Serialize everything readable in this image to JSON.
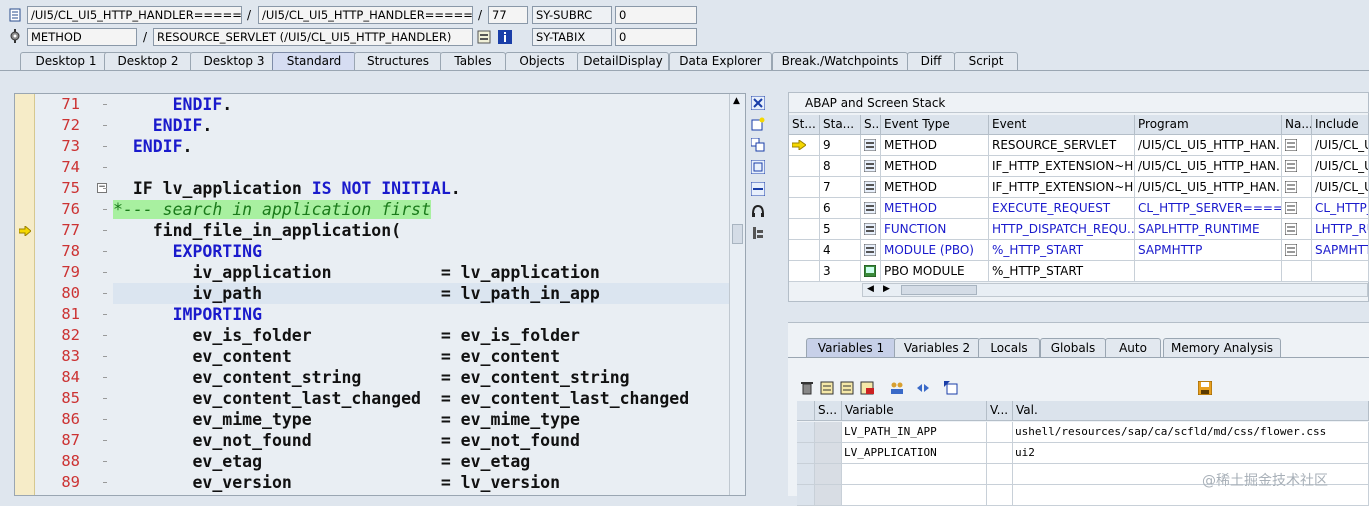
{
  "top_fields": {
    "row1": {
      "class1": "/UI5/CL_UI5_HTTP_HANDLER=====",
      "sep1": "/",
      "class2": "/UI5/CL_UI5_HTTP_HANDLER=====",
      "sep2": "/",
      "line": "77",
      "sys_label": "SY-SUBRC",
      "sys_value": "0"
    },
    "row2": {
      "type": "METHOD",
      "sep1": "/",
      "method": "RESOURCE_SERVLET (/UI5/CL_UI5_HTTP_HANDLER)",
      "sys_label": "SY-TABIX",
      "sys_value": "0"
    }
  },
  "tabs": [
    "Desktop 1",
    "Desktop 2",
    "Desktop 3",
    "Standard",
    "Structures",
    "Tables",
    "Objects",
    "DetailDisplay",
    "Data Explorer",
    "Break./Watchpoints",
    "Diff",
    "Script"
  ],
  "code_lines": [
    {
      "num": "71",
      "parts": [
        {
          "t": "      ",
          "c": ""
        },
        {
          "t": "ENDIF",
          "c": "kw"
        },
        {
          "t": ".",
          "c": ""
        }
      ]
    },
    {
      "num": "72",
      "parts": [
        {
          "t": "    ",
          "c": ""
        },
        {
          "t": "ENDIF",
          "c": "kw"
        },
        {
          "t": ".",
          "c": ""
        }
      ]
    },
    {
      "num": "73",
      "parts": [
        {
          "t": "  ",
          "c": ""
        },
        {
          "t": "ENDIF",
          "c": "kw"
        },
        {
          "t": ".",
          "c": ""
        }
      ]
    },
    {
      "num": "74",
      "parts": []
    },
    {
      "num": "75",
      "parts": [
        {
          "t": "  ",
          "c": ""
        },
        {
          "t": "IF",
          "c": ""
        },
        {
          "t": " lv_application ",
          "c": ""
        },
        {
          "t": "IS NOT INITIAL",
          "c": "kw"
        },
        {
          "t": ".",
          "c": ""
        }
      ]
    },
    {
      "num": "76",
      "parts": [
        {
          "t": "*--- search in application first",
          "c": "cm"
        }
      ]
    },
    {
      "num": "77",
      "parts": [
        {
          "t": "    find_file_in_application(",
          "c": ""
        }
      ]
    },
    {
      "num": "78",
      "parts": [
        {
          "t": "      ",
          "c": ""
        },
        {
          "t": "EXPORTING",
          "c": "kw"
        }
      ]
    },
    {
      "num": "79",
      "parts": [
        {
          "t": "        iv_application           = lv_application",
          "c": ""
        }
      ]
    },
    {
      "num": "80",
      "parts": [
        {
          "t": "        iv_path                  = lv_path_in_app",
          "c": ""
        }
      ]
    },
    {
      "num": "81",
      "parts": [
        {
          "t": "      ",
          "c": ""
        },
        {
          "t": "IMPORTING",
          "c": "kw"
        }
      ]
    },
    {
      "num": "82",
      "parts": [
        {
          "t": "        ev_is_folder             = ev_is_folder",
          "c": ""
        }
      ]
    },
    {
      "num": "83",
      "parts": [
        {
          "t": "        ev_content               = ev_content",
          "c": ""
        }
      ]
    },
    {
      "num": "84",
      "parts": [
        {
          "t": "        ev_content_string        = ev_content_string",
          "c": ""
        }
      ]
    },
    {
      "num": "85",
      "parts": [
        {
          "t": "        ev_content_last_changed  = ev_content_last_changed",
          "c": ""
        }
      ]
    },
    {
      "num": "86",
      "parts": [
        {
          "t": "        ev_mime_type             = ev_mime_type",
          "c": ""
        }
      ]
    },
    {
      "num": "87",
      "parts": [
        {
          "t": "        ev_not_found             = ev_not_found",
          "c": ""
        }
      ]
    },
    {
      "num": "88",
      "parts": [
        {
          "t": "        ev_etag                  = ev_etag",
          "c": ""
        }
      ]
    },
    {
      "num": "89",
      "parts": [
        {
          "t": "        ev_version               = lv_version",
          "c": ""
        }
      ]
    }
  ],
  "stack": {
    "title": "ABAP and Screen Stack",
    "headers": [
      "St...",
      "Sta...",
      "S...",
      "Event Type",
      "Event",
      "Program",
      "Na...",
      "Include"
    ],
    "rows": [
      {
        "level": "9",
        "type": "METHOD",
        "event": "RESOURCE_SERVLET",
        "program": "/UI5/CL_UI5_HTTP_HAN...",
        "include": "/UI5/CL_U",
        "current": true,
        "link": false
      },
      {
        "level": "8",
        "type": "METHOD",
        "event": "IF_HTTP_EXTENSION~H...",
        "program": "/UI5/CL_UI5_HTTP_HAN...",
        "include": "/UI5/CL_U",
        "current": false,
        "link": false
      },
      {
        "level": "7",
        "type": "METHOD",
        "event": "IF_HTTP_EXTENSION~H...",
        "program": "/UI5/CL_UI5_HTTP_HAN...",
        "include": "/UI5/CL_U",
        "current": false,
        "link": false
      },
      {
        "level": "6",
        "type": "METHOD",
        "event": "EXECUTE_REQUEST",
        "program": "CL_HTTP_SERVER====...",
        "include": "CL_HTTP_S",
        "current": false,
        "link": true
      },
      {
        "level": "5",
        "type": "FUNCTION",
        "event": "HTTP_DISPATCH_REQU...",
        "program": "SAPLHTTP_RUNTIME",
        "include": "LHTTP_RU",
        "current": false,
        "link": true
      },
      {
        "level": "4",
        "type": "MODULE (PBO)",
        "event": "%_HTTP_START",
        "program": "SAPMHTTP",
        "include": "SAPMHTT",
        "current": false,
        "link": true
      },
      {
        "level": "3",
        "type": "PBO MODULE",
        "event": "%_HTTP_START",
        "program": "",
        "include": "",
        "current": false,
        "link": false
      }
    ]
  },
  "var_tabs": [
    "Variables 1",
    "Variables 2",
    "Locals",
    "Globals",
    "Auto",
    "Memory Analysis"
  ],
  "vars": {
    "headers": [
      "S...",
      "Variable",
      "V...",
      "Val."
    ],
    "rows": [
      {
        "name": "LV_PATH_IN_APP",
        "value": "ushell/resources/sap/ca/scfld/md/css/flower.css"
      },
      {
        "name": "LV_APPLICATION",
        "value": "ui2"
      }
    ]
  },
  "watermark": "@稀土掘金技术社区"
}
